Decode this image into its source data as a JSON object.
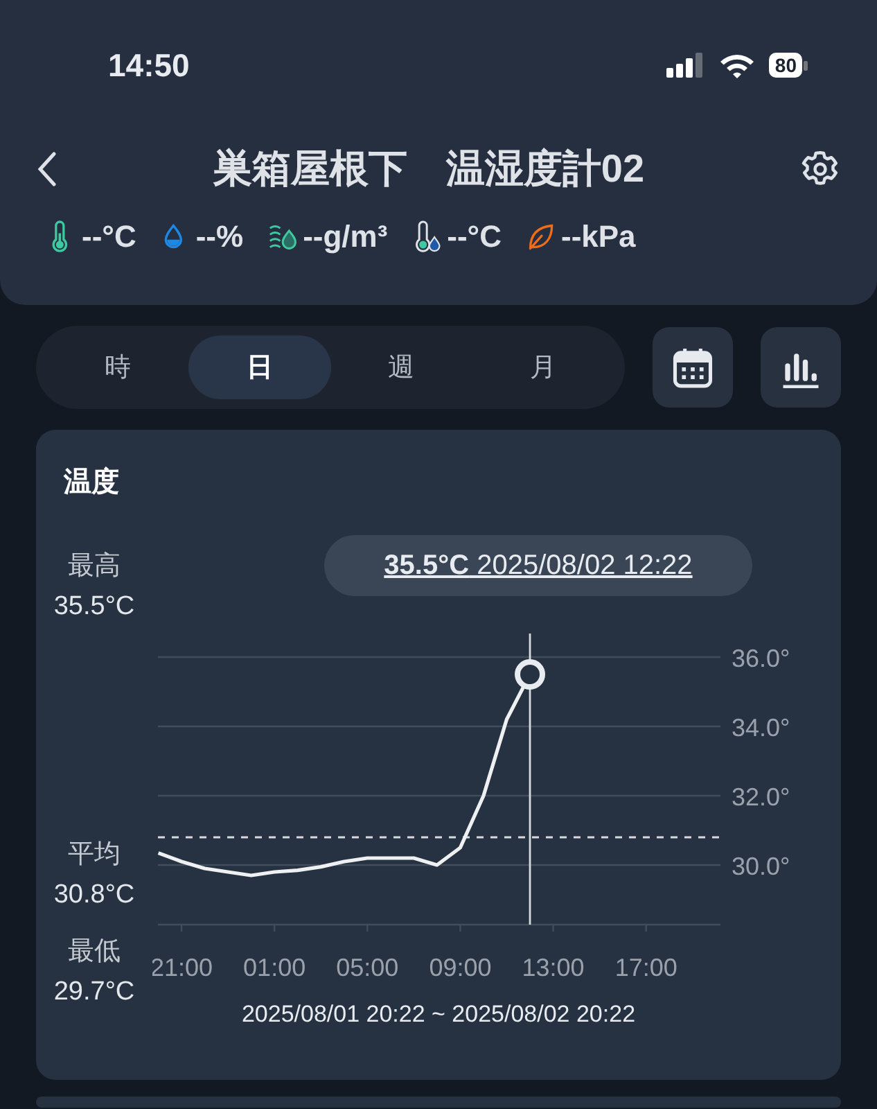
{
  "status_bar": {
    "time": "14:50",
    "battery": "80"
  },
  "header": {
    "title": "巣箱屋根下　温湿度計02"
  },
  "readings": [
    {
      "kind": "temperature",
      "value": "--°C"
    },
    {
      "kind": "humidity",
      "value": "--%"
    },
    {
      "kind": "absolute_humidity",
      "value": "--g/m³"
    },
    {
      "kind": "dew_point",
      "value": "--°C"
    },
    {
      "kind": "vpd",
      "value": "--kPa"
    }
  ],
  "period_tabs": [
    {
      "label": "時",
      "selected": false
    },
    {
      "label": "日",
      "selected": true
    },
    {
      "label": "週",
      "selected": false
    },
    {
      "label": "月",
      "selected": false
    }
  ],
  "chart_card": {
    "title": "温度",
    "tooltip": "**35.5°C** 2025/08/02 12:22",
    "stats": [
      {
        "label": "最高",
        "value": "35.5°C"
      },
      {
        "label": "平均",
        "value": "30.8°C"
      },
      {
        "label": "最低",
        "value": "29.7°C"
      }
    ],
    "chart_data": {
      "type": "line",
      "categories": [
        null,
        "21:00",
        null,
        null,
        null,
        "01:00",
        null,
        null,
        null,
        "05:00",
        null,
        null,
        null,
        "09:00",
        null,
        null,
        null,
        "13:00",
        null,
        null,
        null,
        "17:00",
        null,
        null,
        null
      ],
      "series": [
        {
          "color": "#eef0f2",
          "values": [
            30.35,
            30.1,
            29.9,
            29.8,
            29.7,
            29.8,
            29.85,
            29.95,
            30.1,
            30.2,
            30.2,
            30.2,
            30.0,
            30.5,
            32.0,
            34.2,
            35.5,
            null,
            null,
            null,
            null,
            null,
            null,
            null,
            null
          ]
        }
      ],
      "ylim": [
        28.28,
        36
      ],
      "grid": true,
      "yticks": [
        {
          "value": 30,
          "label": "30.0°"
        },
        {
          "value": 32,
          "label": "32.0°"
        },
        {
          "value": 34,
          "label": "34.0°"
        },
        {
          "value": 36,
          "label": "36.0°"
        }
      ],
      "ref_lines": [
        {
          "axis": "y",
          "value": 30.8
        }
      ]
    },
    "range": "2025/08/01 20:22 ~ 2025/08/02 20:22"
  }
}
